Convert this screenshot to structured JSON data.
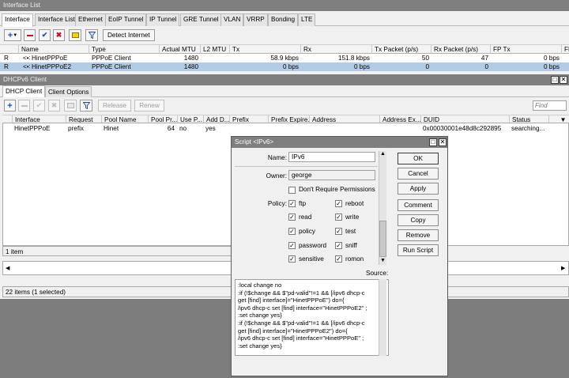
{
  "iface_window": {
    "title": "Interface List",
    "tabs": [
      "Interface",
      "Interface List",
      "Ethernet",
      "EoIP Tunnel",
      "IP Tunnel",
      "GRE Tunnel",
      "VLAN",
      "VRRP",
      "Bonding",
      "LTE"
    ],
    "detect_label": "Detect Internet",
    "columns": [
      "Name",
      "Type",
      "Actual MTU",
      "L2 MTU",
      "Tx",
      "Rx",
      "Tx Packet (p/s)",
      "Rx Packet (p/s)",
      "FP Tx",
      "FP"
    ],
    "rows": [
      {
        "flag": "R",
        "name": "HinetPPPoE",
        "type": "PPPoE Client",
        "mtu": "1480",
        "l2mtu": "",
        "tx": "58.9 kbps",
        "rx": "151.8 kbps",
        "txp": "50",
        "rxp": "47",
        "fptx": "0 bps"
      },
      {
        "flag": "R",
        "name": "HinetPPPoE2",
        "type": "PPPoE Client",
        "mtu": "1480",
        "l2mtu": "",
        "tx": "0 bps",
        "rx": "0 bps",
        "txp": "0",
        "rxp": "0",
        "fptx": "0 bps"
      }
    ]
  },
  "dhcp_window": {
    "title": "DHCPv6 Client",
    "tabs": [
      "DHCP Client",
      "Client Options"
    ],
    "release_label": "Release",
    "renew_label": "Renew",
    "find_placeholder": "Find",
    "columns": [
      "Interface",
      "Request",
      "Pool Name",
      "Pool Pr...",
      "Use P...",
      "Add D...",
      "Prefix",
      "Prefix Expire...",
      "Address",
      "Address Ex...",
      "DUID",
      "Status"
    ],
    "rows": [
      {
        "interface": "HinetPPPoE",
        "request": "prefix",
        "pool": "Hinet",
        "pool_prefix": "64",
        "use_peer": "no",
        "add_default": "yes",
        "prefix": "",
        "prefix_expire": "",
        "address": "",
        "address_expire": "",
        "duid": "0x00030001e48d8c292895",
        "status": "searching..."
      }
    ],
    "item_count": "1 item"
  },
  "bottom_status": "22 items (1 selected)",
  "script_dialog": {
    "title": "Script <IPv6>",
    "name_label": "Name:",
    "name_value": "IPv6",
    "owner_label": "Owner:",
    "owner_value": "george",
    "dont_require_label": "Don't Require Permissions",
    "policy_label": "Policy:",
    "policies": [
      "ftp",
      "reboot",
      "read",
      "write",
      "policy",
      "test",
      "password",
      "sniff",
      "sensitive",
      "romon"
    ],
    "source_label": "Source:",
    "source": ":local change no\n:if (!$change && $\"pd-valid\"!=1 && [/ipv6 dhcp-c\nget [find] interface]=\"HinetPPPoE\") do={\n/ipv6 dhcp-c set [find] interface=\"HinetPPPoE2\" ;\n:set change yes}\n:if (!$change && $\"pd-valid\"!=1 && [/ipv6 dhcp-c\nget [find] interface]=\"HinetPPPoE2\") do={\n/ipv6 dhcp-c set [find] interface=\"HinetPPPoE\" ;\n:set change yes}",
    "buttons": {
      "ok": "OK",
      "cancel": "Cancel",
      "apply": "Apply",
      "comment": "Comment",
      "copy": "Copy",
      "remove": "Remove",
      "run": "Run Script"
    }
  },
  "colors": {
    "selection": "#b3cce6",
    "title_bar": "#7f7f7f",
    "add_blue": "#1f4fb8",
    "remove_red": "#c0142a"
  }
}
